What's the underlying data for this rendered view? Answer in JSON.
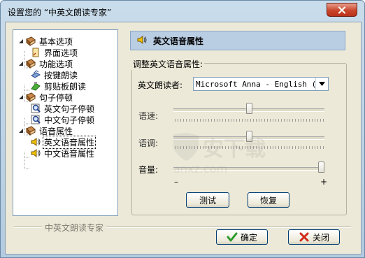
{
  "window": {
    "title": "设置您的 “中英文朗读专家”",
    "close_icon": "close-x-icon"
  },
  "tree": {
    "items": [
      {
        "label": "基本选项",
        "level": 0,
        "expanded": true,
        "icon": "book-icon"
      },
      {
        "label": "界面选项",
        "level": 1,
        "icon": "page-icon"
      },
      {
        "label": "功能选项",
        "level": 0,
        "expanded": true,
        "icon": "book-icon"
      },
      {
        "label": "按键朗读",
        "level": 1,
        "icon": "keyboard-icon"
      },
      {
        "label": "剪贴板朗读",
        "level": 1,
        "icon": "clipboard-icon"
      },
      {
        "label": "句子停顿",
        "level": 0,
        "expanded": true,
        "icon": "book-icon"
      },
      {
        "label": "英文句子停顿",
        "level": 1,
        "icon": "magnifier-icon"
      },
      {
        "label": "中文句子停顿",
        "level": 1,
        "icon": "magnifier-icon"
      },
      {
        "label": "语音属性",
        "level": 0,
        "expanded": true,
        "icon": "book-icon"
      },
      {
        "label": "英文语音属性",
        "level": 1,
        "icon": "speaker-icon",
        "selected": true
      },
      {
        "label": "中文语音属性",
        "level": 1,
        "icon": "speaker-icon"
      }
    ]
  },
  "panel": {
    "header_title": "英文语音属性",
    "header_icon": "speaker-icon",
    "group_label": "调整英文语音属性:",
    "reader_label": "英文朗读者:",
    "reader_value": "Microsoft Anna - English (Un",
    "speed_label": "语速:",
    "speed_level": 0.5,
    "pitch_label": "语调:",
    "pitch_level": 0.5,
    "volume_label": "音量:",
    "volume_level": 1.0,
    "min_label": "–",
    "max_label": "+",
    "test_label": "测试",
    "reset_label": "恢复"
  },
  "footer": {
    "brand_label": "中英文朗读专家",
    "ok_label": "确定",
    "cancel_label": "关闭"
  },
  "watermark": {
    "text": "安下载",
    "domain": "anxz.com"
  }
}
